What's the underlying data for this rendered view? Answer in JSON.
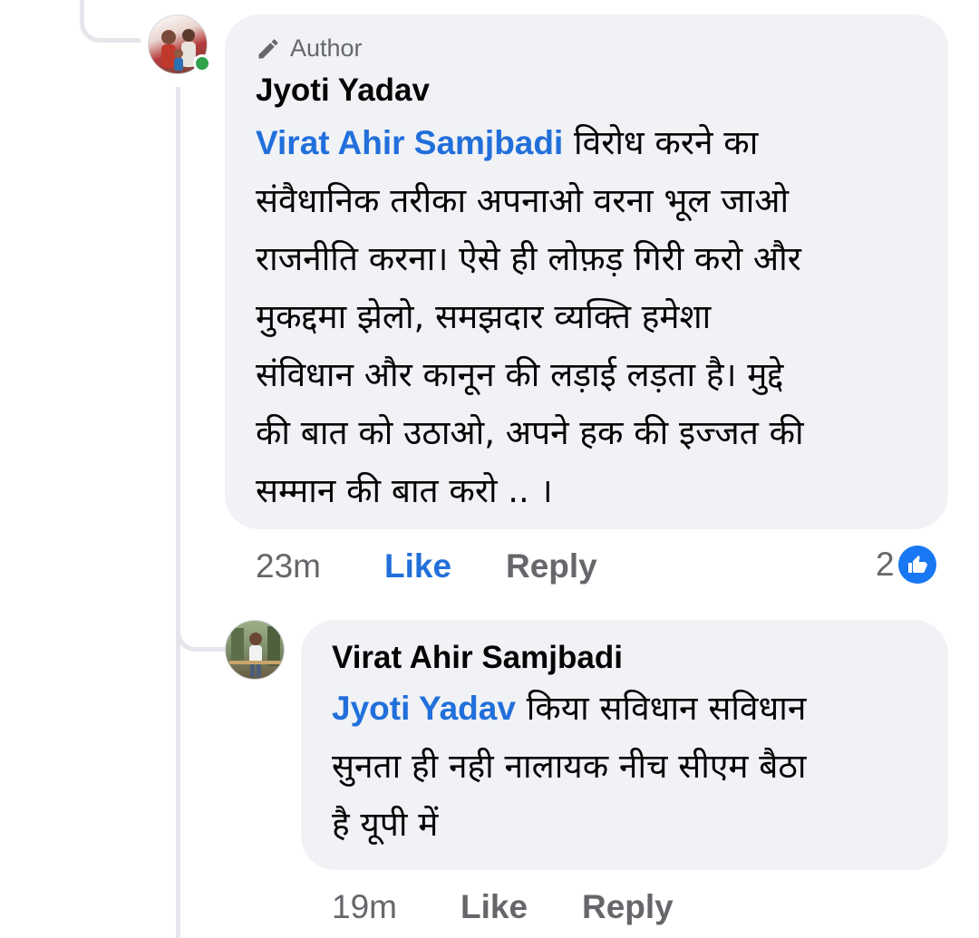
{
  "comment": {
    "author_badge": "Author",
    "author_name": "Jyoti Yadav",
    "mention": "Virat Ahir Samjbadi",
    "text": " विरोध करने का\nसंवैधानिक तरीका अपनाओ वरना भूल जाओ\nराजनीति करना। ऐसे ही लोफ़ड़ गिरी करो और\nमुकद्दमा झेलो, समझदार व्यक्ति हमेशा\nसंविधान और कानून की लड़ाई लड़ता है। मुद्दे\nकी बात को उठाओ, अपने हक की इज्जत की\nसम्मान की बात करो .. ।",
    "time": "23m",
    "like_label": "Like",
    "reply_label": "Reply",
    "reaction_count": "2",
    "reaction_icon": "like-reaction-icon",
    "avatar_icon": "profile-photo",
    "online": true
  },
  "reply": {
    "author_name": "Virat Ahir Samjbadi",
    "mention": "Jyoti Yadav",
    "text": " किया सविधान सविधान\nसुनता ही नही नालायक नीच सीएम बैठा\nहै यूपी में",
    "time": "19m",
    "like_label": "Like",
    "reply_label": "Reply",
    "avatar_icon": "profile-photo"
  },
  "colors": {
    "bubble": "#f0f2f5",
    "link": "#216fdb",
    "secondary_text": "#65676b",
    "online": "#31a24c",
    "reaction": "#1877f2"
  }
}
